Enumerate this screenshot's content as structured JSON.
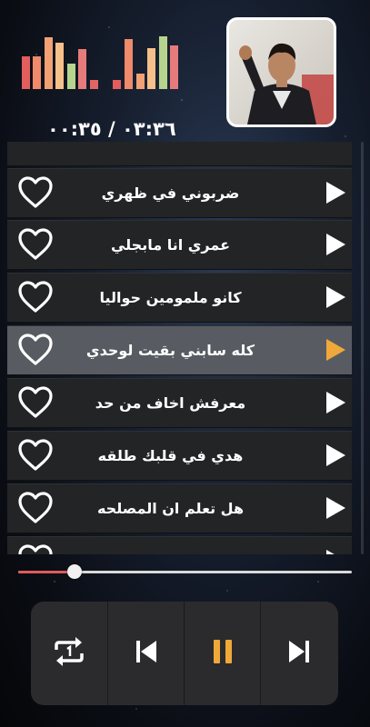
{
  "player": {
    "time_display": "٠٣:٣٦ / ٠٠:٣٥",
    "progress_fraction": 0.17,
    "album_art": "artist-photo"
  },
  "equalizer": {
    "colors": [
      "#e35d5d",
      "#ef8a6b",
      "#f1a174",
      "#f6c08a",
      "#b7d48f",
      "#e77a7a",
      "#e06565"
    ],
    "levels": [
      0.62,
      0.62,
      0.98,
      0.88,
      0.48,
      0.75,
      0.18,
      0.18,
      0.95,
      0.3,
      0.78,
      1.0,
      0.82
    ]
  },
  "playlist": {
    "active_index": 3,
    "items": [
      {
        "title": "ضربوني في ظهري"
      },
      {
        "title": "عمري انا مابجلي"
      },
      {
        "title": "كانو ملمومين حواليا"
      },
      {
        "title": "كله سابني بقيت لوحدي"
      },
      {
        "title": "معرفش اخاف من حد"
      },
      {
        "title": "هدي في قلبك طلقه"
      },
      {
        "title": "هل تعلم ان المصلحه"
      }
    ]
  },
  "controls": {
    "items": [
      "repeat-one-icon",
      "previous-icon",
      "pause-icon",
      "next-icon"
    ],
    "accent_color": "#f0a83a"
  }
}
